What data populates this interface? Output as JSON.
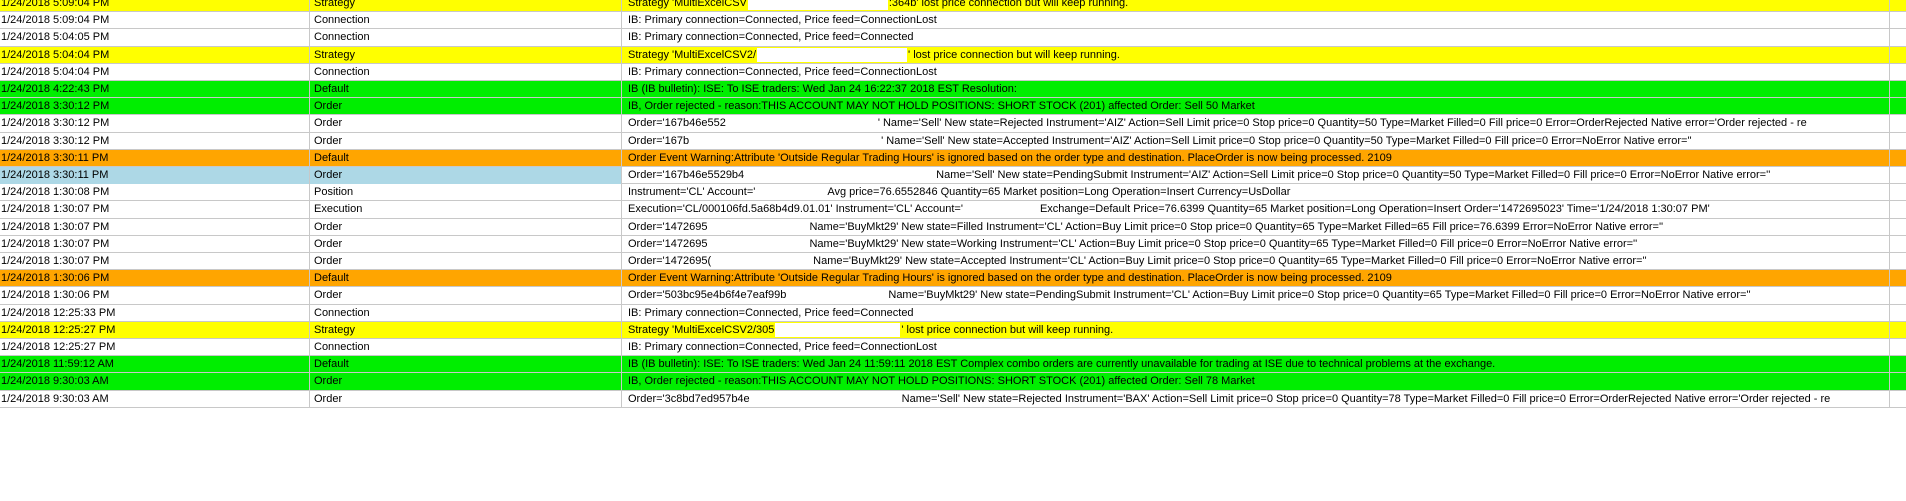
{
  "colors": {
    "strategy": "#ffff00",
    "green": "#00ee00",
    "warning": "#ffa500",
    "selected": "#add8e6",
    "default": "#ffffff",
    "grid": "#c8c8c8"
  },
  "log": {
    "rows": [
      {
        "time": "1/24/2018 5:09:04 PM",
        "category": "Strategy",
        "style": "strategy",
        "message_a": "Strategy 'MultiExcelCSV",
        "redact": 140,
        "message_b": ":364b' lost price connection but will keep running."
      },
      {
        "time": "1/24/2018 5:09:04 PM",
        "category": "Connection",
        "style": "connection",
        "message_a": "IB: Primary connection=Connected, Price feed=ConnectionLost",
        "redact": 0,
        "message_b": ""
      },
      {
        "time": "1/24/2018 5:04:05 PM",
        "category": "Connection",
        "style": "connection",
        "message_a": "IB: Primary connection=Connected, Price feed=Connected",
        "redact": 0,
        "message_b": ""
      },
      {
        "time": "1/24/2018 5:04:04 PM",
        "category": "Strategy",
        "style": "strategy",
        "message_a": "Strategy 'MultiExcelCSV2/",
        "redact": 150,
        "message_b": "' lost price connection but will keep running."
      },
      {
        "time": "1/24/2018 5:04:04 PM",
        "category": "Connection",
        "style": "connection",
        "message_a": "IB: Primary connection=Connected, Price feed=ConnectionLost",
        "redact": 0,
        "message_b": ""
      },
      {
        "time": "1/24/2018 4:22:43 PM",
        "category": "Default",
        "style": "default-green",
        "message_a": "IB (IB bulletin): ISE: To ISE traders: Wed Jan 24 16:22:37 2018 EST Resolution:",
        "redact": 0,
        "message_b": ""
      },
      {
        "time": "1/24/2018 3:30:12 PM",
        "category": "Order",
        "style": "order-green",
        "message_a": "IB, Order rejected - reason:THIS ACCOUNT MAY NOT HOLD POSITIONS: SHORT STOCK  (201) affected Order: Sell 50 Market",
        "redact": 0,
        "message_b": ""
      },
      {
        "time": "1/24/2018 3:30:12 PM",
        "category": "Order",
        "style": "order",
        "message_a": "Order='167b46e552",
        "redact": 150,
        "message_b": "' Name='Sell' New state=Rejected Instrument='AIZ' Action=Sell Limit price=0 Stop price=0 Quantity=50 Type=Market Filled=0 Fill price=0 Error=OrderRejected Native error='Order rejected - re"
      },
      {
        "time": "1/24/2018 3:30:12 PM",
        "category": "Order",
        "style": "order",
        "message_a": "Order='167b",
        "redact": 190,
        "message_b": "' Name='Sell' New state=Accepted Instrument='AIZ' Action=Sell Limit price=0 Stop price=0 Quantity=50 Type=Market Filled=0 Fill price=0 Error=NoError Native error=''"
      },
      {
        "time": "1/24/2018 3:30:11 PM",
        "category": "Default",
        "style": "warning",
        "message_a": "Order Event Warning:Attribute 'Outside Regular Trading Hours' is ignored based on the order type and destination. PlaceOrder is now being processed. 2109",
        "redact": 0,
        "message_b": ""
      },
      {
        "time": "1/24/2018 3:30:11 PM",
        "category": "Order",
        "style": "order",
        "selected": true,
        "message_a": "Order='167b46e5529b4",
        "redact": 190,
        "message_b": "Name='Sell' New state=PendingSubmit Instrument='AIZ' Action=Sell Limit price=0 Stop price=0 Quantity=50 Type=Market Filled=0 Fill price=0 Error=NoError Native error=''"
      },
      {
        "time": "1/24/2018 1:30:08 PM",
        "category": "Position",
        "style": "position",
        "message_a": "Instrument='CL' Account='",
        "redact": 70,
        "message_b": "Avg price=76.6552846 Quantity=65 Market position=Long Operation=Insert Currency=UsDollar"
      },
      {
        "time": "1/24/2018 1:30:07 PM",
        "category": "Execution",
        "style": "execution",
        "message_a": "Execution='CL/000106fd.5a68b4d9.01.01' Instrument='CL' Account='",
        "redact": 75,
        "message_b": "Exchange=Default  Price=76.6399 Quantity=65 Market position=Long Operation=Insert Order='1472695023'  Time='1/24/2018  1:30:07  PM'"
      },
      {
        "time": "1/24/2018 1:30:07 PM",
        "category": "Order",
        "style": "order",
        "message_a": "Order='1472695",
        "redact": 100,
        "message_b": "Name='BuyMkt29' New state=Filled Instrument='CL' Action=Buy Limit price=0 Stop price=0 Quantity=65 Type=Market Filled=65 Fill price=76.6399 Error=NoError Native error=''"
      },
      {
        "time": "1/24/2018 1:30:07 PM",
        "category": "Order",
        "style": "order",
        "message_a": "Order='1472695",
        "redact": 100,
        "message_b": "Name='BuyMkt29' New state=Working Instrument='CL' Action=Buy Limit price=0 Stop price=0 Quantity=65 Type=Market Filled=0 Fill price=0 Error=NoError Native error=''"
      },
      {
        "time": "1/24/2018 1:30:07 PM",
        "category": "Order",
        "style": "order",
        "message_a": "Order='1472695(",
        "redact": 100,
        "message_b": "Name='BuyMkt29' New state=Accepted Instrument='CL' Action=Buy Limit price=0 Stop price=0 Quantity=65 Type=Market Filled=0 Fill price=0 Error=NoError Native error=''"
      },
      {
        "time": "1/24/2018 1:30:06 PM",
        "category": "Default",
        "style": "warning",
        "message_a": "Order Event Warning:Attribute 'Outside Regular Trading Hours' is ignored based on the order type and destination. PlaceOrder is now being processed. 2109",
        "redact": 0,
        "message_b": ""
      },
      {
        "time": "1/24/2018 1:30:06 PM",
        "category": "Order",
        "style": "order",
        "message_a": "Order='503bc95e4b6f4e7eaf99b",
        "redact": 100,
        "message_b": "Name='BuyMkt29' New state=PendingSubmit Instrument='CL' Action=Buy Limit price=0 Stop price=0 Quantity=65 Type=Market Filled=0 Fill price=0 Error=NoError Native error=''"
      },
      {
        "time": "1/24/2018 12:25:33 PM",
        "category": "Connection",
        "style": "connection",
        "message_a": "IB: Primary connection=Connected, Price feed=Connected",
        "redact": 0,
        "message_b": ""
      },
      {
        "time": "1/24/2018 12:25:27 PM",
        "category": "Strategy",
        "style": "strategy",
        "message_a": "Strategy 'MultiExcelCSV2/305",
        "redact": 125,
        "message_b": "' lost price connection but will keep running."
      },
      {
        "time": "1/24/2018 12:25:27 PM",
        "category": "Connection",
        "style": "connection",
        "message_a": "IB: Primary connection=Connected, Price feed=ConnectionLost",
        "redact": 0,
        "message_b": ""
      },
      {
        "time": "1/24/2018 11:59:12 AM",
        "category": "Default",
        "style": "default-green",
        "message_a": "IB (IB bulletin): ISE: To ISE traders: Wed Jan 24 11:59:11 2018 EST Complex combo orders are currently unavailable for trading at ISE due to technical problems at the exchange.",
        "redact": 0,
        "message_b": ""
      },
      {
        "time": "1/24/2018 9:30:03 AM",
        "category": "Order",
        "style": "order-green",
        "message_a": "IB, Order rejected - reason:THIS ACCOUNT MAY NOT HOLD POSITIONS: SHORT STOCK  (201) affected Order: Sell 78 Market",
        "redact": 0,
        "message_b": ""
      },
      {
        "time": "1/24/2018 9:30:03 AM",
        "category": "Order",
        "style": "order",
        "message_a": "Order='3c8bd7ed957b4e",
        "redact": 150,
        "message_b": "Name='Sell' New state=Rejected Instrument='BAX' Action=Sell Limit price=0 Stop price=0 Quantity=78 Type=Market Filled=0 Fill price=0 Error=OrderRejected Native error='Order rejected - re"
      }
    ]
  }
}
